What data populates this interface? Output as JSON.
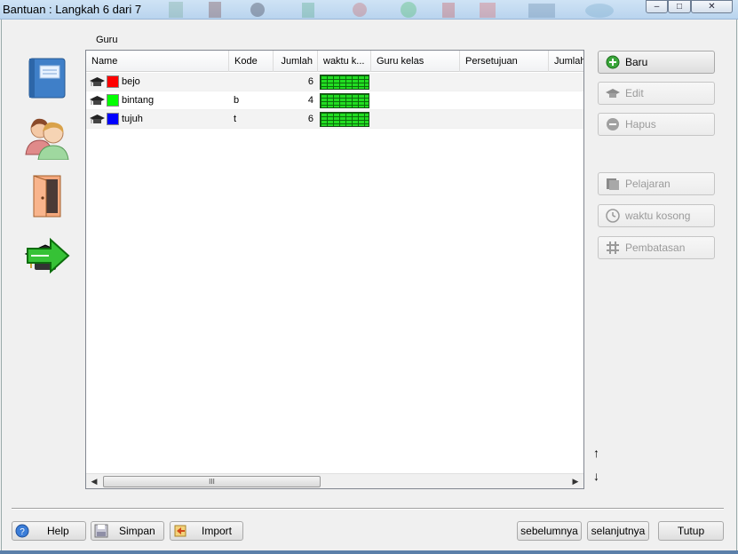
{
  "window": {
    "title": "Bantuan : Langkah 6 dari 7",
    "min_glyph": "–",
    "max_glyph": "□",
    "close_glyph": "✕"
  },
  "sidebar": {
    "icons": [
      "notebook-icon",
      "people-icon",
      "door-icon",
      "graduation-cap-arrow-icon"
    ]
  },
  "section_label": "Guru",
  "table": {
    "columns": [
      "Name",
      "Kode",
      "Jumlah",
      "waktu k...",
      "Guru kelas",
      "Persetujuan",
      "Jumlah"
    ],
    "rows": [
      {
        "name": "bejo",
        "color": "#ff0000",
        "kode": "",
        "jumlah": "6"
      },
      {
        "name": "bintang",
        "color": "#00ff00",
        "kode": "b",
        "jumlah": "4"
      },
      {
        "name": "tujuh",
        "color": "#0000ff",
        "kode": "t",
        "jumlah": "6"
      }
    ],
    "scroll_thumb_glyph": "III",
    "scroll_left_glyph": "◀",
    "scroll_right_glyph": "▶"
  },
  "actions": {
    "baru": "Baru",
    "edit": "Edit",
    "hapus": "Hapus",
    "pelajaran": "Pelajaran",
    "waktu_kosong": "waktu kosong",
    "pembatasan": "Pembatasan",
    "move_up": "↑",
    "move_down": "↓"
  },
  "footer": {
    "help": "Help",
    "simpan": "Simpan",
    "import": "Import",
    "sebelumnya": "sebelumnya",
    "selanjutnya": "selanjutnya",
    "tutup": "Tutup"
  },
  "colors": {
    "accent_green": "#3aa63a",
    "grid_green": "#22dd22"
  }
}
